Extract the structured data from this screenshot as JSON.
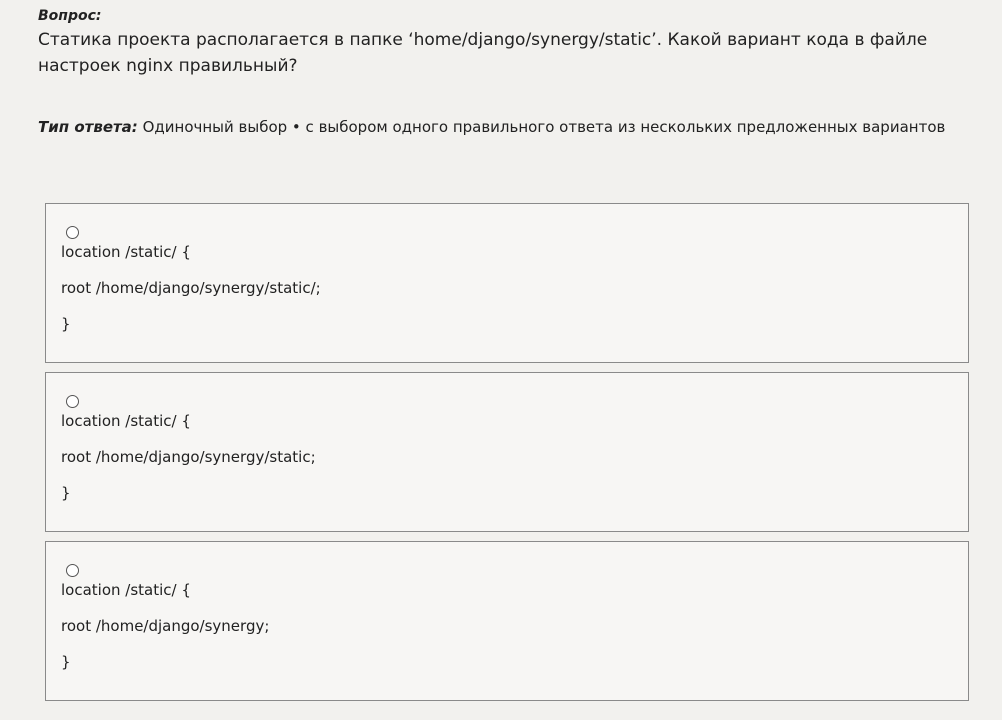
{
  "question": {
    "label": "Вопрос:",
    "text": "Статика проекта располагается в папке ‘home/django/synergy/static’. Какой вариант кода в файле настроек nginx правильный?"
  },
  "answer_type": {
    "label": "Тип ответа:",
    "value": "Одиночный выбор • с выбором одного правильного ответа из нескольких предложенных вариантов"
  },
  "options": [
    {
      "line1": "location /static/ {",
      "line2": "root /home/django/synergy/static/;",
      "line3": "}"
    },
    {
      "line1": "location /static/ {",
      "line2": "root /home/django/synergy/static;",
      "line3": "}"
    },
    {
      "line1": "location /static/ {",
      "line2": "root /home/django/synergy;",
      "line3": "}"
    }
  ]
}
